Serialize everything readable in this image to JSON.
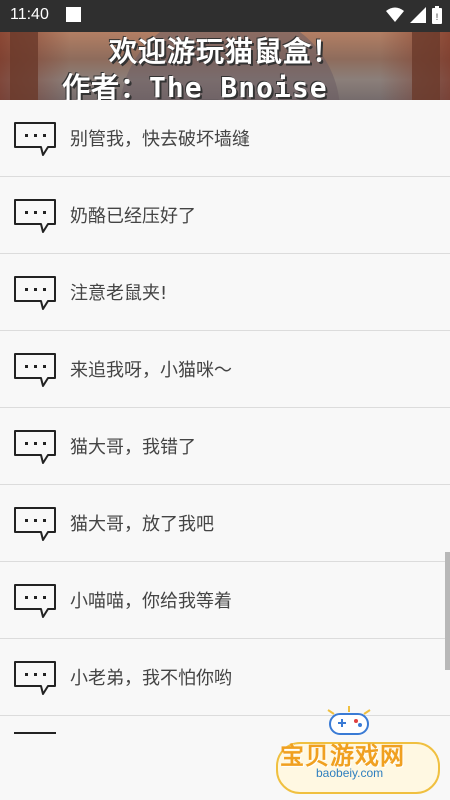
{
  "status_bar": {
    "time": "11:40"
  },
  "banner": {
    "line1": "欢迎游玩猫鼠盒！",
    "line2": "作者：The_Bnoise"
  },
  "messages": [
    {
      "icon": "chat-bubble-icon",
      "text": "别管我，快去破坏墙缝"
    },
    {
      "icon": "chat-bubble-icon",
      "text": "奶酪已经压好了"
    },
    {
      "icon": "chat-bubble-icon",
      "text": "注意老鼠夹!"
    },
    {
      "icon": "chat-bubble-icon",
      "text": "来追我呀，小猫咪～"
    },
    {
      "icon": "chat-bubble-icon",
      "text": "猫大哥，我错了"
    },
    {
      "icon": "chat-bubble-icon",
      "text": "猫大哥，放了我吧"
    },
    {
      "icon": "chat-bubble-icon",
      "text": "小喵喵，你给我等着"
    },
    {
      "icon": "chat-bubble-icon",
      "text": "小老弟，我不怕你哟"
    }
  ],
  "watermark": {
    "name": "宝贝游戏网",
    "url": "baobeiy.com"
  }
}
